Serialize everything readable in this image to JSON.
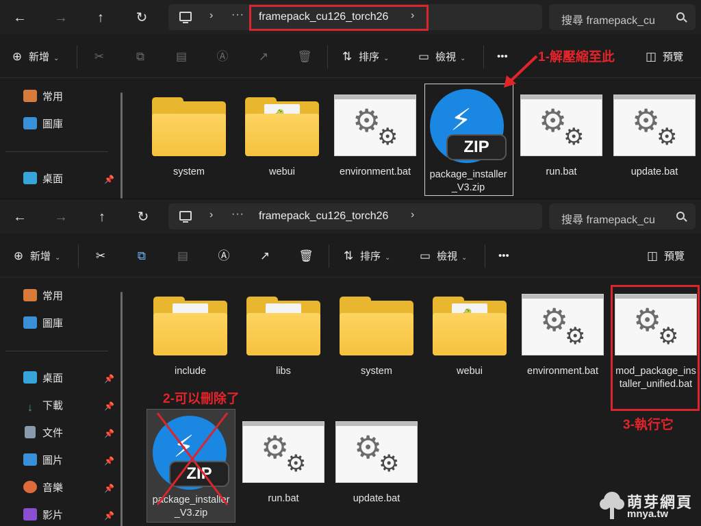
{
  "window_top": {
    "address": {
      "path": "framepack_cu126_torch26",
      "search_placeholder": "搜尋 framepack_cu"
    },
    "toolbar": {
      "new_label": "新增",
      "sort_label": "排序",
      "view_label": "檢視",
      "more_label": "•••",
      "preview_label": "預覽"
    },
    "sidebar": {
      "items": [
        {
          "label": "常用",
          "icon": "home-icon"
        },
        {
          "label": "圖庫",
          "icon": "gallery-icon"
        },
        {
          "label": "桌面",
          "icon": "desktop-icon",
          "pinned": true
        }
      ]
    },
    "files": [
      {
        "name": "system",
        "type": "folder"
      },
      {
        "name": "webui",
        "type": "folder-python"
      },
      {
        "name": "environment.bat",
        "type": "bat"
      },
      {
        "name": "package_installer_V3.zip",
        "type": "zip",
        "selected": true
      },
      {
        "name": "run.bat",
        "type": "bat"
      },
      {
        "name": "update.bat",
        "type": "bat"
      }
    ],
    "annotation": "1-解壓縮至此"
  },
  "window_bottom": {
    "address": {
      "path": "framepack_cu126_torch26",
      "search_placeholder": "搜尋 framepack_cu"
    },
    "toolbar": {
      "new_label": "新增",
      "sort_label": "排序",
      "view_label": "檢視",
      "more_label": "•••",
      "preview_label": "預覽"
    },
    "sidebar": {
      "items": [
        {
          "label": "常用",
          "icon": "home-icon"
        },
        {
          "label": "圖庫",
          "icon": "gallery-icon"
        },
        {
          "label": "桌面",
          "icon": "desktop-icon",
          "pinned": true
        },
        {
          "label": "下載",
          "icon": "download-icon",
          "pinned": true
        },
        {
          "label": "文件",
          "icon": "document-icon",
          "pinned": true
        },
        {
          "label": "圖片",
          "icon": "pictures-icon",
          "pinned": true
        },
        {
          "label": "音樂",
          "icon": "music-icon",
          "pinned": true
        },
        {
          "label": "影片",
          "icon": "video-icon",
          "pinned": true
        }
      ]
    },
    "files": [
      {
        "name": "include",
        "type": "folder-doc"
      },
      {
        "name": "libs",
        "type": "folder-libs"
      },
      {
        "name": "system",
        "type": "folder"
      },
      {
        "name": "webui",
        "type": "folder-python"
      },
      {
        "name": "environment.bat",
        "type": "bat"
      },
      {
        "name": "mod_package_installer_unified.bat",
        "type": "bat",
        "highlighted": true
      },
      {
        "name": "package_installer_V3.zip",
        "type": "zip",
        "crossed_out": true
      },
      {
        "name": "run.bat",
        "type": "bat"
      },
      {
        "name": "update.bat",
        "type": "bat"
      }
    ],
    "annotations": {
      "delete": "2-可以刪除了",
      "run": "3-執行它"
    }
  },
  "watermark": {
    "title": "萌芽網頁",
    "url": "mnya.tw"
  },
  "colors": {
    "annotation_red": "#d8262c",
    "folder_yellow": "#f6c23e",
    "zip_blue": "#1a87e2",
    "background": "#1c1c1c"
  }
}
